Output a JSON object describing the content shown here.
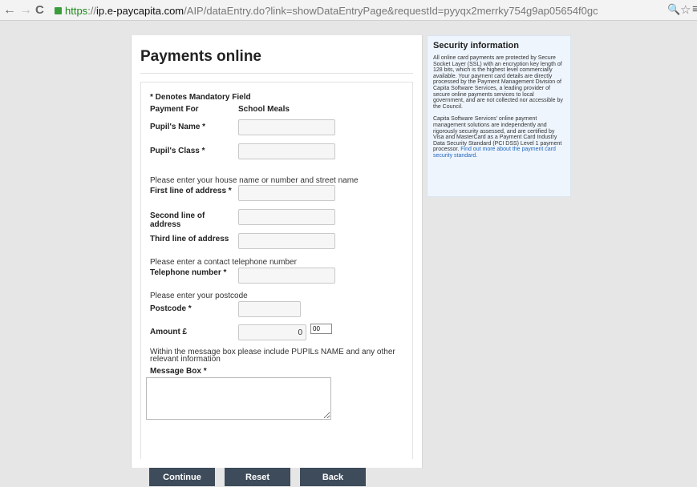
{
  "browser": {
    "url_secure": "https",
    "url_separator": "://",
    "url_host": "ip.e-paycapita.com",
    "url_path": "/AIP/dataEntry.do?link=showDataEntryPage&requestId=pyyqx2merrky754g9ap05654f0gc",
    "back_glyph": "←",
    "forward_glyph": "→",
    "reload_glyph": "C",
    "zoom_glyph": "🔍",
    "star_glyph": "☆",
    "menu_glyph": "≡"
  },
  "page": {
    "title": "Payments online"
  },
  "form": {
    "mandatory_note": "* Denotes Mandatory Field",
    "payment_for_label": "Payment For",
    "payment_for_value": "School Meals",
    "pupil_name_label": "Pupil's Name *",
    "pupil_name_value": "",
    "pupil_class_label": "Pupil's Class *",
    "pupil_class_value": "",
    "address_instruction": "Please enter your house name or number and street name",
    "address1_label": "First line of address *",
    "address1_value": "",
    "address2_label": "Second line of address",
    "address2_value": "",
    "address3_label": "Third line of address",
    "address3_value": "",
    "phone_instruction": "Please enter a contact telephone number",
    "phone_label": "Telephone number *",
    "phone_value": "",
    "postcode_instruction": "Please enter your postcode",
    "postcode_label": "Postcode *",
    "postcode_value": "",
    "amount_label": "Amount £",
    "amount_pounds": "0",
    "amount_separator": ".",
    "amount_pence": "00",
    "message_instruction": "Within the message box please include PUPILs NAME and any other relevant information",
    "message_label": "Message Box *",
    "message_value": "",
    "continue_label": "Continue",
    "reset_label": "Reset",
    "back_label": "Back"
  },
  "security": {
    "title": "Security information",
    "para1": "All online card payments are protected by Secure Socket Layer (SSL) with an encryption key length of 128 bits, which is the highest level commercially available. Your payment card details are directly processed by the Payment Management Division of Capita Software Services, a leading provider of secure online payments services to local government, and are not collected nor accessible by the Council.",
    "para2": "Capita Software Services' online payment management solutions are independently and rigorously security assessed, and are certified by Visa and MasterCard as a Payment Card Industry Data Security Standard (PCI DSS) Level 1 payment processor.",
    "link": "Find out more about the payment card security standard."
  },
  "colors": {
    "button_bg": "#3d4b5a",
    "sidebar_bg": "#eef5fd",
    "link": "#2266bb",
    "secure_green": "#1b8a1b"
  }
}
